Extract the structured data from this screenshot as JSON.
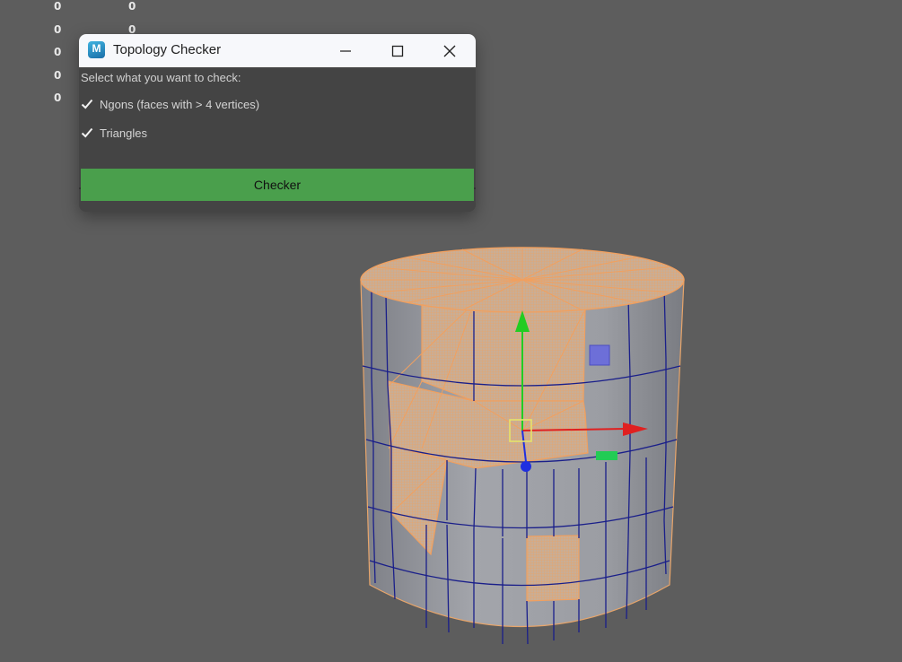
{
  "hud": {
    "rows": [
      {
        "a": "0",
        "b": "0"
      },
      {
        "a": "0",
        "b": "0"
      },
      {
        "a": "0"
      },
      {
        "a": "0"
      },
      {
        "a": "0"
      }
    ]
  },
  "dialog": {
    "icon_letter": "M",
    "title": "Topology Checker",
    "prompt": "Select what you want to check:",
    "options": [
      {
        "label": "Ngons (faces with > 4 vertices)",
        "checked": true
      },
      {
        "label": "Triangles",
        "checked": true
      }
    ],
    "checker_label": "Checker"
  },
  "colors": {
    "viewport_bg": "#5d5d5d",
    "dialog_bg": "#444444",
    "titlebar_bg": "#f7f8fb",
    "checker_button": "#4a9f4c",
    "selection_orange": "#f0a060",
    "wire_blue": "#1a1f8a",
    "axis_x": "#e02020",
    "axis_y": "#22cc22",
    "axis_z": "#1f2fe0"
  },
  "icons": {
    "minimize": "minimize-icon",
    "maximize": "maximize-icon",
    "close": "close-icon",
    "check": "checkmark-icon"
  }
}
